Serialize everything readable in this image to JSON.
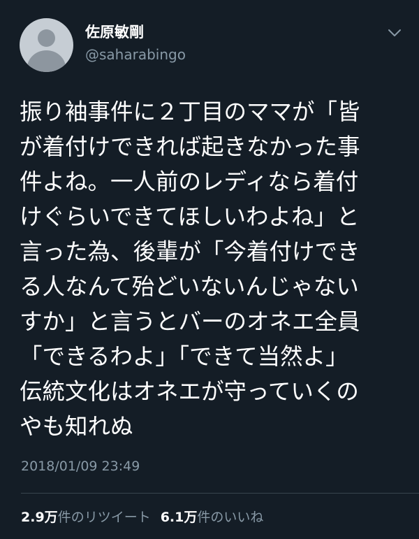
{
  "user": {
    "display_name": "佐原敏剛",
    "handle": "@saharabingo",
    "avatar_icon": "default-avatar-icon",
    "menu_icon": "chevron-down-icon"
  },
  "tweet": {
    "text": "振り袖事件に２丁目のママが「皆\nが着付けできれば起きなかった事\n件よね。一人前のレディなら着付\nけぐらいできてほしいわよね」と\n言った為、後輩が「今着付けでき\nる人なんて殆どいないんじゃない\nすか」と言うとバーのオネエ全員\n「できるわよ」「できて当然よ」\n伝統文化はオネエが守っていくの\nやも知れぬ",
    "timestamp": "2018/01/09 23:49"
  },
  "stats": {
    "retweets_count": "2.9",
    "retweets_unit": "万",
    "retweets_label": "件のリツイート",
    "likes_count": "6.1",
    "likes_unit": "万",
    "likes_label": "件のいいね"
  },
  "colors": {
    "background": "#141d26",
    "primary_text": "#ffffff",
    "secondary_text": "#8899a6",
    "divider": "#38444d"
  }
}
